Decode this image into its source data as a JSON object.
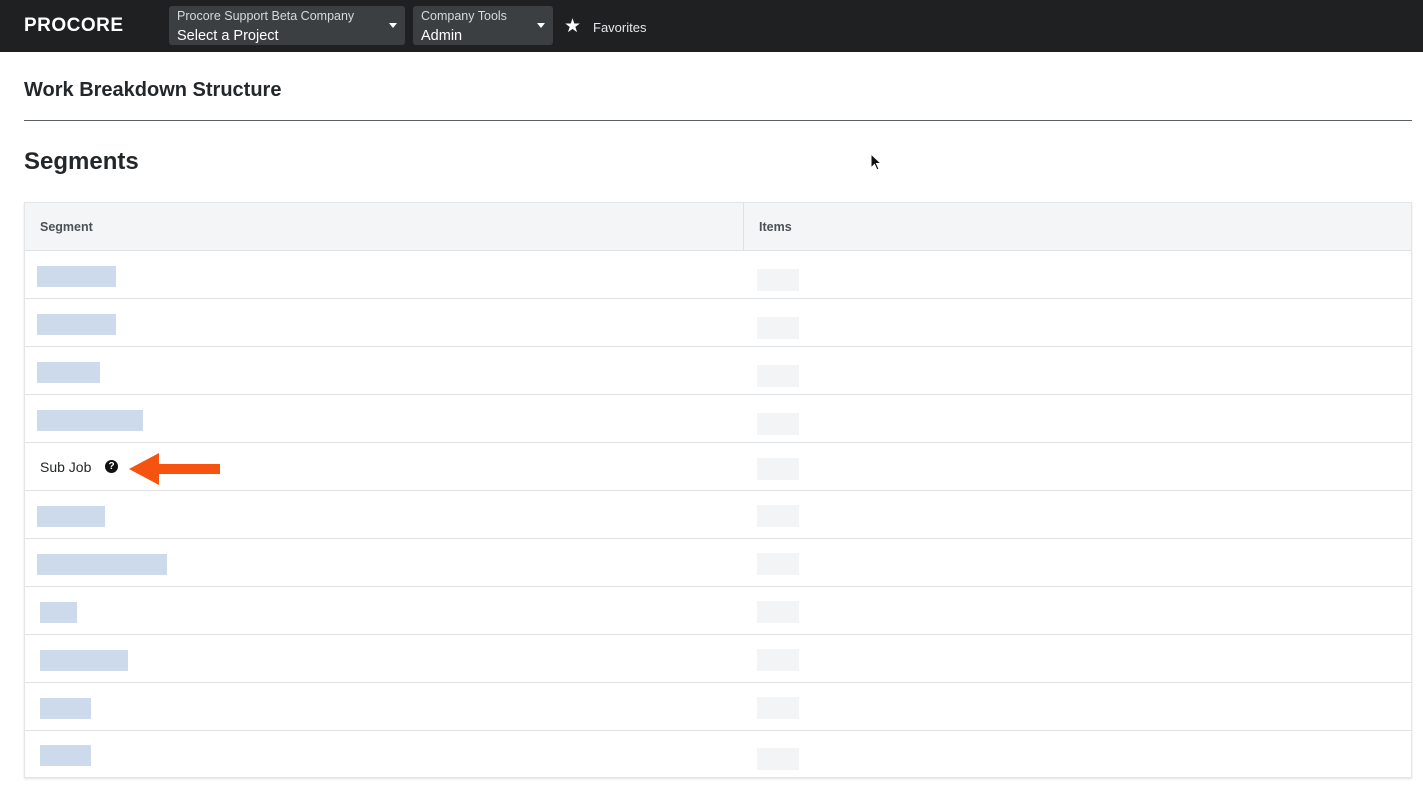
{
  "header": {
    "logo_text": "PROCORE",
    "company_picker": {
      "label": "Procore Support Beta Company",
      "value": "Select a Project"
    },
    "tools_picker": {
      "label": "Company Tools",
      "value": "Admin"
    },
    "favorites_label": "Favorites"
  },
  "page": {
    "title": "Work Breakdown Structure",
    "section_title": "Segments"
  },
  "table": {
    "columns": [
      "Segment",
      "Items"
    ],
    "rows": [
      {
        "segment": "",
        "redacted": true
      },
      {
        "segment": "",
        "redacted": true
      },
      {
        "segment": "",
        "redacted": true
      },
      {
        "segment": "",
        "redacted": true
      },
      {
        "segment": "Sub Job",
        "redacted": false,
        "has_help_icon": true,
        "highlighted_by_arrow": true
      },
      {
        "segment": "",
        "redacted": true
      },
      {
        "segment": "",
        "redacted": true
      },
      {
        "segment": "",
        "redacted": true
      },
      {
        "segment": "",
        "redacted": true
      },
      {
        "segment": "",
        "redacted": true
      },
      {
        "segment": "",
        "redacted": true
      }
    ]
  },
  "icons": {
    "favorites": "star-icon",
    "help": "question-circle-icon",
    "annotation": "arrow-left-icon",
    "pointer": "mouse-cursor-icon"
  },
  "colors": {
    "topbar": "#1f2021",
    "annotation_arrow": "#f5530f",
    "redaction": "#ccdaec"
  }
}
